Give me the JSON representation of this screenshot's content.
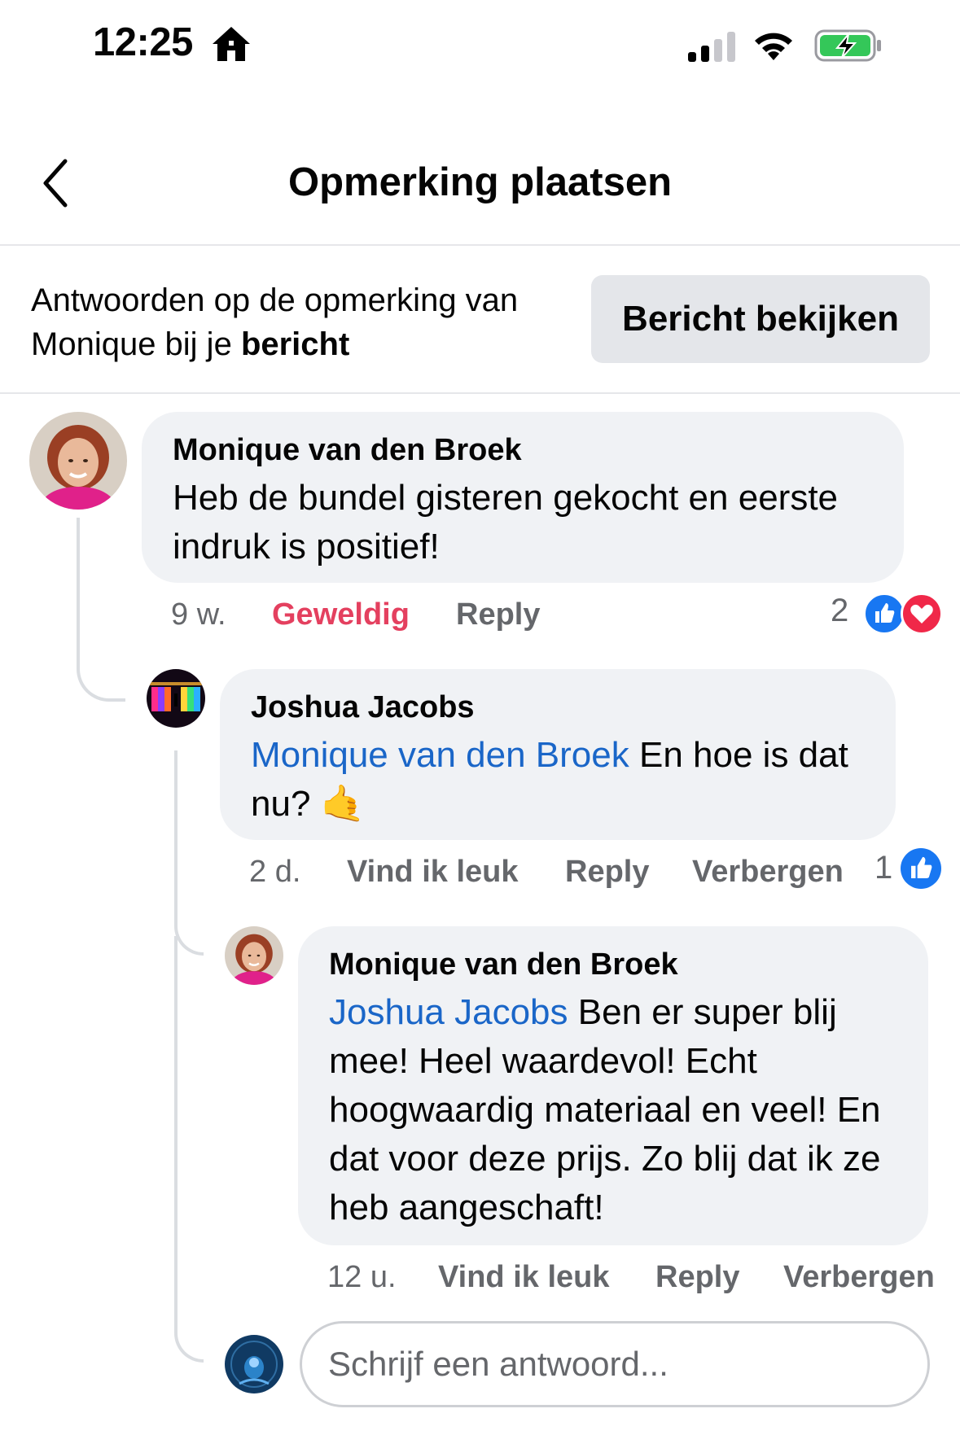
{
  "status_bar": {
    "time": "12:25",
    "icons": [
      "home-icon",
      "cellular-signal-icon",
      "wifi-icon",
      "battery-charging-icon"
    ]
  },
  "header": {
    "title": "Opmerking plaatsen",
    "back_icon": "chevron-left-icon"
  },
  "context": {
    "text_prefix": "Antwoorden op de opmerking van Monique bij je ",
    "text_bold": "bericht",
    "view_button_label": "Bericht bekijken"
  },
  "comments": [
    {
      "author": "Monique van den Broek",
      "mention": "",
      "text": "Heb de bundel gisteren gekocht en eerste indruk is positief!",
      "time": "9 w.",
      "like_label": "Geweldig",
      "reply_label": "Reply",
      "hide_label": "",
      "reaction_count": "2",
      "reactions": [
        "like-reaction-icon",
        "love-reaction-icon"
      ]
    },
    {
      "author": "Joshua Jacobs",
      "mention": "Monique van den Broek",
      "text": "En hoe is dat nu? 🤙",
      "time": "2 d.",
      "like_label": "Vind ik leuk",
      "reply_label": "Reply",
      "hide_label": "Verbergen",
      "reaction_count": "1",
      "reactions": [
        "like-reaction-icon"
      ]
    },
    {
      "author": "Monique van den Broek",
      "mention": "Joshua Jacobs",
      "text": "Ben er super blij mee! Heel waardevol! Echt hoogwaardig materiaal en veel! En dat voor deze prijs. Zo blij dat ik ze heb aangeschaft!",
      "time": "12 u.",
      "like_label": "Vind ik leuk",
      "reply_label": "Reply",
      "hide_label": "Verbergen",
      "reaction_count": "",
      "reactions": []
    }
  ],
  "composer": {
    "placeholder": "Schrijf een antwoord..."
  },
  "colors": {
    "mention": "#1a66c8",
    "loved_reaction_label": "#e4405f",
    "bubble_bg": "#f0f2f5",
    "secondary_text": "#65676b",
    "like_blue": "#1877f2",
    "love_red": "#f02849",
    "battery_green": "#34c759"
  }
}
